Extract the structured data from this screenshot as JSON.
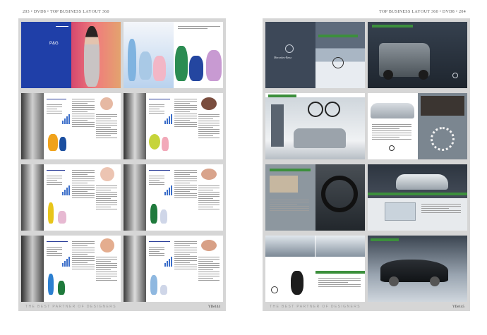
{
  "header": {
    "left_text": "203 • DVD8 • TOP BUSINESS LAYOUT 360",
    "right_text": "TOP BUSINESS LAYOUT 360 • DVD8 • 204"
  },
  "left_spread": {
    "footer_tagline": "THE BEST PARTNER OF DESIGNERS",
    "footer_code": "YDe144",
    "ad_brand": "P&G"
  },
  "right_spread": {
    "footer_tagline": "THE BEST PARTNER OF DESIGNERS",
    "footer_code": "YDe145",
    "brochure_title": "Mercedes-Benz"
  }
}
